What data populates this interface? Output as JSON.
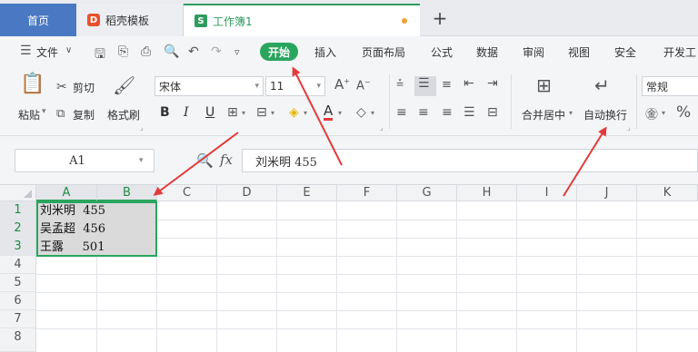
{
  "tabs": {
    "home": "首页",
    "template": "稻壳模板",
    "template_logo": "D",
    "workbook": "工作簿1",
    "workbook_logo": "S",
    "add": "+"
  },
  "menu": {
    "file": "文件",
    "start": "开始",
    "insert": "插入",
    "page_layout": "页面布局",
    "formula": "公式",
    "data": "数据",
    "review": "审阅",
    "view": "视图",
    "security": "安全",
    "developer": "开发工"
  },
  "ribbon": {
    "paste": "粘贴",
    "cut": "剪切",
    "copy": "复制",
    "format_painter": "格式刷",
    "font_name": "宋体",
    "font_size": "11",
    "bold": "B",
    "italic": "I",
    "underline": "U",
    "merge_center": "合并居中",
    "wrap_text": "自动换行",
    "number_format": "常规",
    "percent": "%"
  },
  "formula_bar": {
    "name_box": "A1",
    "fx": "fx",
    "content": "刘米明  455"
  },
  "grid": {
    "columns": [
      "A",
      "B",
      "C",
      "D",
      "E",
      "F",
      "G",
      "H",
      "I",
      "J",
      "K"
    ],
    "rows": [
      "1",
      "2",
      "3",
      "4",
      "5",
      "6",
      "7",
      "8"
    ],
    "cells": [
      {
        "ref": "A1",
        "text": "刘米明  455"
      },
      {
        "ref": "A2",
        "text": "吴孟超  456"
      },
      {
        "ref": "A3",
        "text": "王露     501"
      }
    ]
  },
  "colors": {
    "accent_green": "#2aa55e",
    "home_tab_blue": "#4a78c2",
    "annotation_red": "#e23b3b",
    "selection_gray": "#dadada"
  }
}
